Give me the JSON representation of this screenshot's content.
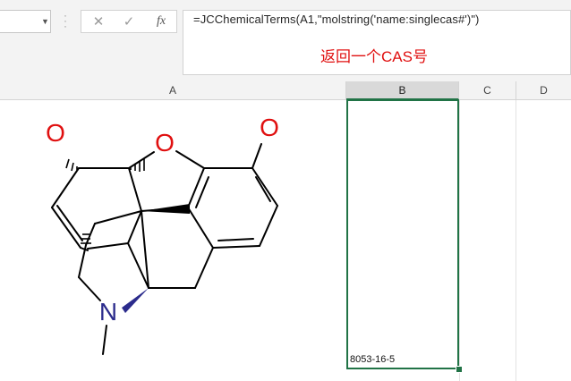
{
  "formula_bar": {
    "cancel_icon": "✕",
    "enter_icon": "✓",
    "function_icon": "fx",
    "formula": "=JCChemicalTerms(A1,\"molstring('name:singlecas#')\")",
    "annotation": "返回一个CAS号",
    "annotation_color": "#e01010"
  },
  "columns": [
    "A",
    "B",
    "C",
    "D"
  ],
  "cells": {
    "B_last_row_value": "8053-16-5"
  },
  "molecule": {
    "atoms": [
      "O",
      "O",
      "O",
      "N"
    ],
    "heteroatom_colors": {
      "O": "#e01010",
      "N": "#2b2b8c"
    }
  },
  "colors": {
    "selection": "#217346",
    "header_bg": "#f3f3f3",
    "selected_header_bg": "#d9d9d9"
  }
}
